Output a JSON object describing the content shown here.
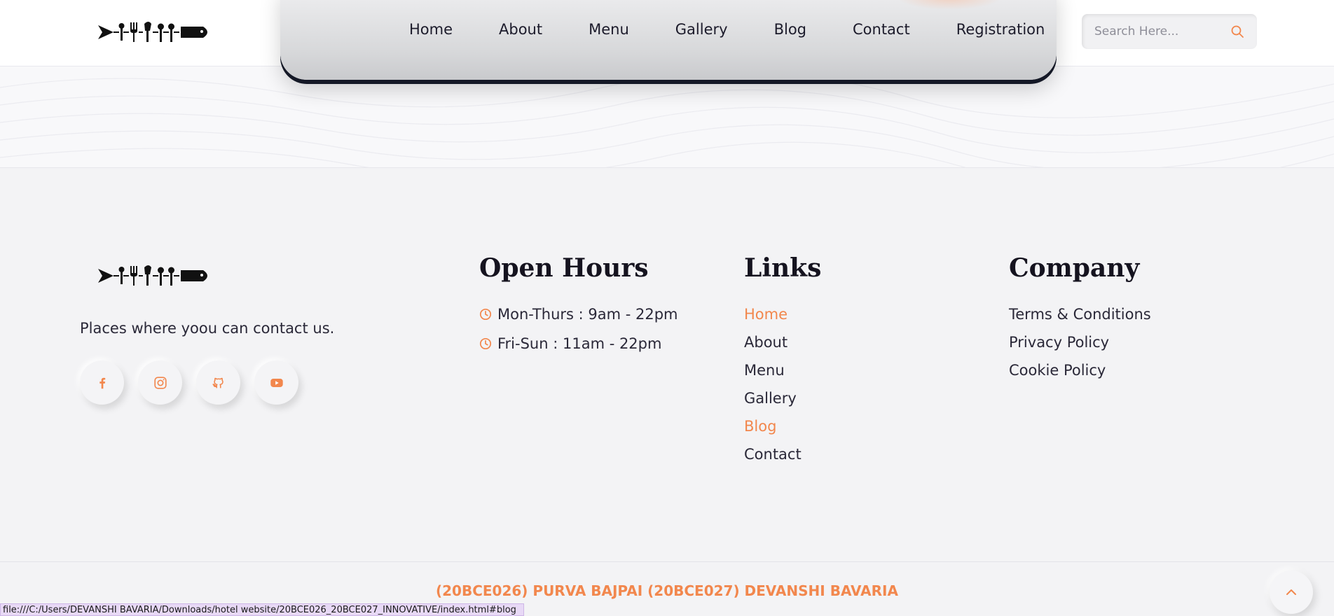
{
  "header": {
    "logo_icon": "fork-knife-spoon-fish-logo",
    "nav": {
      "items": [
        "Home",
        "About",
        "Menu",
        "Gallery",
        "Blog",
        "Contact",
        "Registration"
      ]
    },
    "search": {
      "placeholder": "Search Here...",
      "value": "",
      "icon": "search-icon"
    }
  },
  "footer": {
    "about": {
      "tagline": "Places where yoou can contact us.",
      "socials": [
        {
          "name": "facebook",
          "icon": "facebook-icon"
        },
        {
          "name": "instagram",
          "icon": "instagram-icon"
        },
        {
          "name": "github",
          "icon": "github-icon"
        },
        {
          "name": "youtube",
          "icon": "youtube-icon"
        }
      ]
    },
    "hours": {
      "title": "Open Hours",
      "items": [
        "Mon-Thurs : 9am - 22pm",
        "Fri-Sun : 11am - 22pm"
      ]
    },
    "links": {
      "title": "Links",
      "items": [
        "Home",
        "About",
        "Menu",
        "Gallery",
        "Blog",
        "Contact"
      ],
      "highlighted": [
        "Home",
        "Blog"
      ]
    },
    "company": {
      "title": "Company",
      "items": [
        "Terms & Conditions",
        "Privacy Policy",
        "Cookie Policy"
      ]
    },
    "credits": "(20BCE026) PURVA BAJPAI (20BCE027) DEVANSHI BAVARIA"
  },
  "status_bar": {
    "url": "file:///C:/Users/DEVANSHI BAVARIA/Downloads/hotel website/20BCE026_20BCE027_INNOVATIVE/index.html#blog"
  },
  "colors": {
    "accent": "#f2874d",
    "text_dark": "#1c1b2b",
    "background": "#f3f3f5"
  }
}
